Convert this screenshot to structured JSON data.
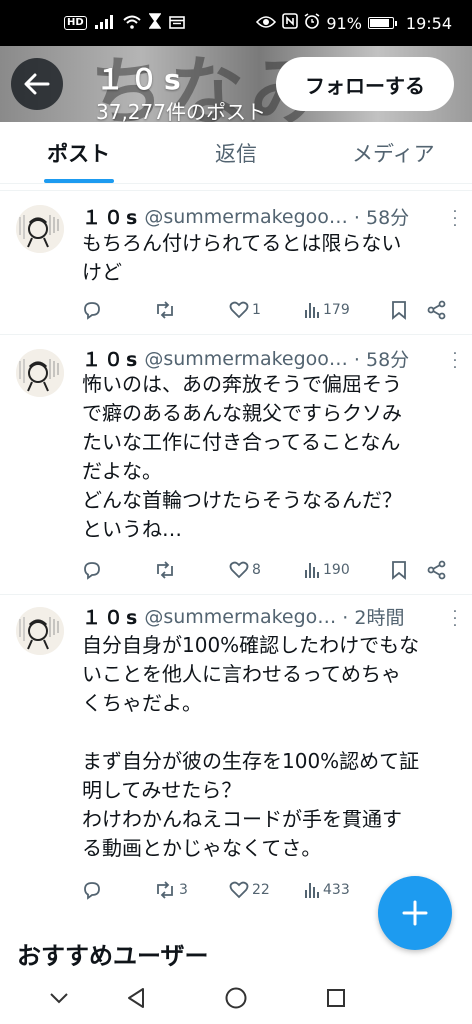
{
  "status_bar": {
    "hd_badge": "HD",
    "battery": "91%",
    "battery_level": 0.91,
    "time": "19:54"
  },
  "header": {
    "banner_text": "ちなみ",
    "name": "１０s",
    "post_count": "37,277件のポスト",
    "follow_label": "フォローする"
  },
  "tabs": [
    {
      "label": "ポスト",
      "active": true
    },
    {
      "label": "返信",
      "active": false
    },
    {
      "label": "メディア",
      "active": false
    }
  ],
  "posts": [
    {
      "name": "１０s",
      "handle": "@summermakegoo…",
      "time": "· 58分",
      "text": "もちろん付けられてるとは限らない\nけど",
      "replies": "",
      "reposts": "",
      "likes": "1",
      "views": "179"
    },
    {
      "name": "１０s",
      "handle": "@summermakegoo…",
      "time": "· 58分",
      "text": "怖いのは、あの奔放そうで偏屈そう\nで癖のあるあんな親父ですらクソみ\nたいな工作に付き合ってることなん\nだよな。\nどんな首輪つけたらそうなるんだ？\nというね…",
      "replies": "",
      "reposts": "",
      "likes": "8",
      "views": "190"
    },
    {
      "name": "１０s",
      "handle": "@summermakego…",
      "time": "· 2時間",
      "text": "自分自身が100%確認したわけでもな\nいことを他人に言わせるってめちゃ\nくちゃだよ。\n\nまず自分が彼の生存を100%認めて証\n明してみせたら？\nわけわかんねえコードが手を貫通す\nる動画とかじゃなくてさ。",
      "replies": "",
      "reposts": "3",
      "likes": "22",
      "views": "433"
    }
  ],
  "recommended_title": "おすすめユーザー",
  "colors": {
    "accent": "#1d9bf0",
    "text": "#0f1419",
    "muted": "#536471",
    "divider": "#eff3f4"
  }
}
